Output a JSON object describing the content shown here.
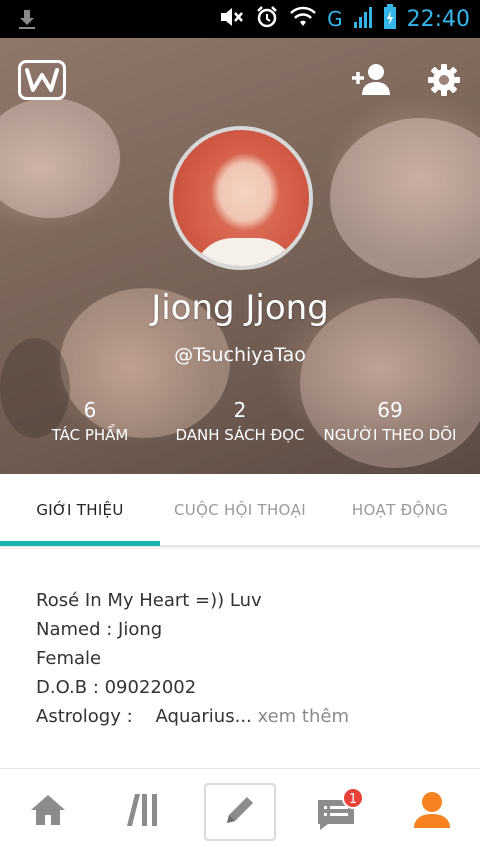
{
  "status_bar": {
    "time": "22:40",
    "network": "G",
    "icons": [
      "download-icon",
      "mute-icon",
      "alarm-icon",
      "wifi-icon",
      "signal-icon",
      "battery-charging-icon"
    ]
  },
  "header": {
    "logo": "W",
    "icons": [
      "add-user-icon",
      "gear-icon"
    ]
  },
  "profile": {
    "display_name": "Jiong Jjong",
    "username": "@TsuchiyaTao",
    "stats": [
      {
        "value": "6",
        "label": "TÁC PHẨM"
      },
      {
        "value": "2",
        "label": "DANH SÁCH ĐỌC"
      },
      {
        "value": "69",
        "label": "NGƯỜI THEO DÕI"
      }
    ]
  },
  "tabs": [
    {
      "label": "GIỚI THIỆU",
      "active": true
    },
    {
      "label": "CUỘC HỘI THOẠI",
      "active": false
    },
    {
      "label": "HOẠT ĐỘNG",
      "active": false
    }
  ],
  "about": {
    "lines": [
      "Rosé In My Heart =)) Luv",
      "Named : Jiong",
      "Female",
      "D.O.B : 09022002",
      "Astrology :    Aquarius"
    ],
    "ellipsis": "...",
    "more": " xem thêm"
  },
  "bottom_nav": {
    "items": [
      "home-icon",
      "library-icon",
      "write-icon",
      "messages-icon",
      "profile-icon"
    ],
    "messages_badge": "1"
  },
  "colors": {
    "accent": "#17b3b0",
    "brand_orange": "#f5821f",
    "badge": "#e8413a",
    "status_time": "#35b6e9"
  }
}
